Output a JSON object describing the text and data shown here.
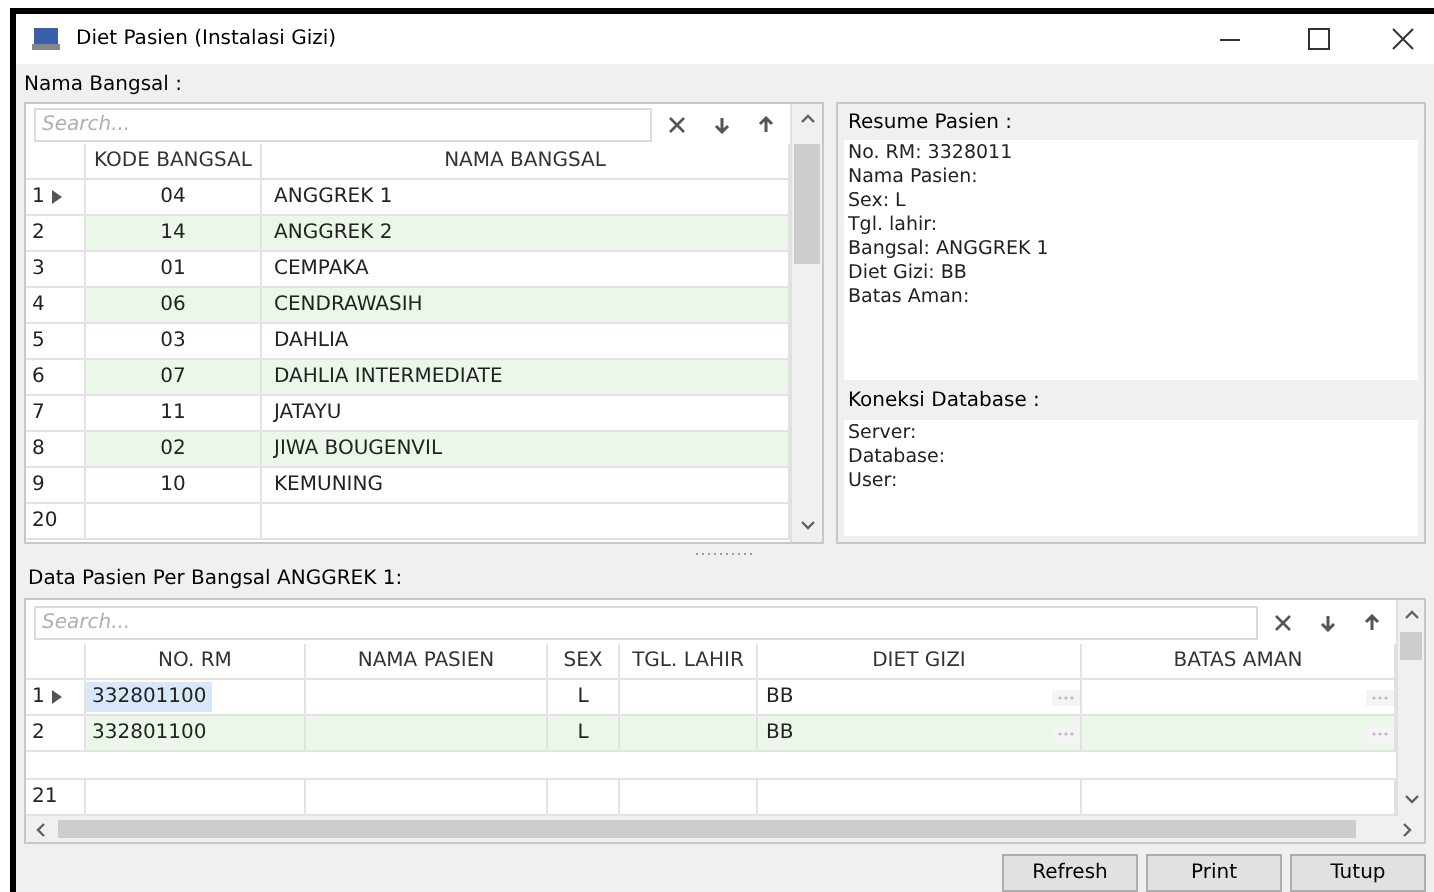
{
  "window": {
    "title": "Diet Pasien (Instalasi Gizi)"
  },
  "bangsal": {
    "label": "Nama Bangsal :",
    "search": {
      "placeholder": "Search..."
    },
    "columns": [
      "KODE BANGSAL",
      "NAMA BANGSAL"
    ],
    "rows": [
      {
        "num": "1",
        "kode": "04",
        "nama": "ANGGREK 1",
        "selected": true
      },
      {
        "num": "2",
        "kode": "14",
        "nama": "ANGGREK 2",
        "selected": false
      },
      {
        "num": "3",
        "kode": "01",
        "nama": "CEMPAKA",
        "selected": false
      },
      {
        "num": "4",
        "kode": "06",
        "nama": "CENDRAWASIH",
        "selected": false
      },
      {
        "num": "5",
        "kode": "03",
        "nama": "DAHLIA",
        "selected": false
      },
      {
        "num": "6",
        "kode": "07",
        "nama": "DAHLIA INTERMEDIATE",
        "selected": false
      },
      {
        "num": "7",
        "kode": "11",
        "nama": "JATAYU",
        "selected": false
      },
      {
        "num": "8",
        "kode": "02",
        "nama": "JIWA BOUGENVIL",
        "selected": false
      },
      {
        "num": "9",
        "kode": "10",
        "nama": "KEMUNING",
        "selected": false
      }
    ],
    "footer_count": "20"
  },
  "resume": {
    "title": "Resume Pasien :",
    "lines": [
      "No. RM: 3328011",
      "Nama Pasien:",
      "Sex: L",
      "Tgl. lahir:",
      "Bangsal: ANGGREK 1",
      "Diet Gizi: BB",
      "Batas Aman:"
    ]
  },
  "koneksi": {
    "title": "Koneksi Database :",
    "lines": [
      "Server:",
      "Database:",
      "User:"
    ]
  },
  "pasien": {
    "label": "Data Pasien Per Bangsal ANGGREK 1:",
    "search": {
      "placeholder": "Search..."
    },
    "columns": [
      "NO. RM",
      "NAMA PASIEN",
      "SEX",
      "TGL. LAHIR",
      "DIET GIZI",
      "BATAS AMAN"
    ],
    "rows": [
      {
        "num": "1",
        "no_rm": "332801100",
        "sex": "L",
        "diet": "BB",
        "selected": true
      },
      {
        "num": "2",
        "no_rm": "332801100",
        "sex": "L",
        "diet": "BB",
        "selected": false
      }
    ],
    "footer_count": "21"
  },
  "buttons": [
    "Refresh",
    "Print",
    "Tutup"
  ]
}
